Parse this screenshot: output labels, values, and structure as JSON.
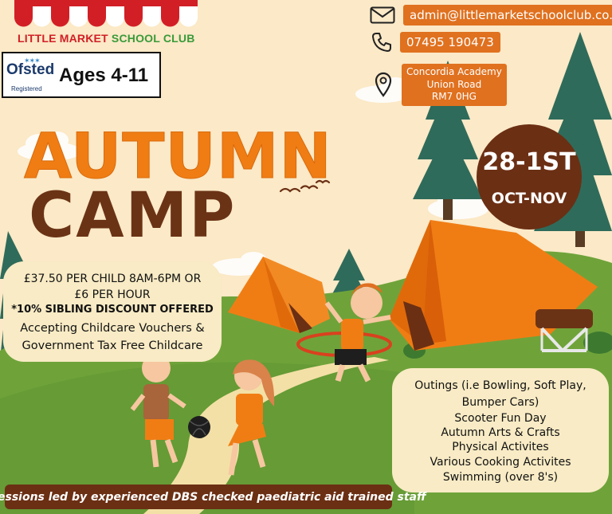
{
  "brand": {
    "logo_little": "LITTLE MARKET",
    "logo_school": "SCHOOL CLUB"
  },
  "ofsted": {
    "name": "Ofsted",
    "registered": "Registered",
    "ages": "Ages 4-11"
  },
  "contact": {
    "email": "admin@littlemarketschoolclub.co.uk",
    "phone": "07495 190473",
    "address": [
      "Concordia Academy",
      "Union Road",
      "RM7 0HG"
    ]
  },
  "title": {
    "line1": "AUTUMN",
    "line2": "CAMP"
  },
  "dates": {
    "main": "28-1ST",
    "sub": "OCT-NOV"
  },
  "pricing": [
    "£37.50 PER CHILD 8AM-6PM OR",
    "£6 PER HOUR",
    "*10% SIBLING DISCOUNT OFFERED",
    "Accepting Childcare Vouchers &",
    "Government Tax Free Childcare"
  ],
  "activities": [
    "Outings (i.e Bowling, Soft Play,",
    "Bumper Cars)",
    "Scooter Fun Day",
    "Autumn Arts & Crafts",
    "Physical Activites",
    "Various Cooking Activites",
    "Swimming (over 8's)"
  ],
  "footer": "All sessions led by experienced DBS checked paediatric aid trained staff",
  "colors": {
    "orange": "#f07d14",
    "brown": "#6b2f14",
    "grass": "#6fa33a",
    "tree": "#2f6b5a",
    "cream": "#f8ebc5",
    "background": "#fbe9c7"
  },
  "icons": [
    "envelope-icon",
    "phone-icon",
    "location-pin-icon"
  ]
}
